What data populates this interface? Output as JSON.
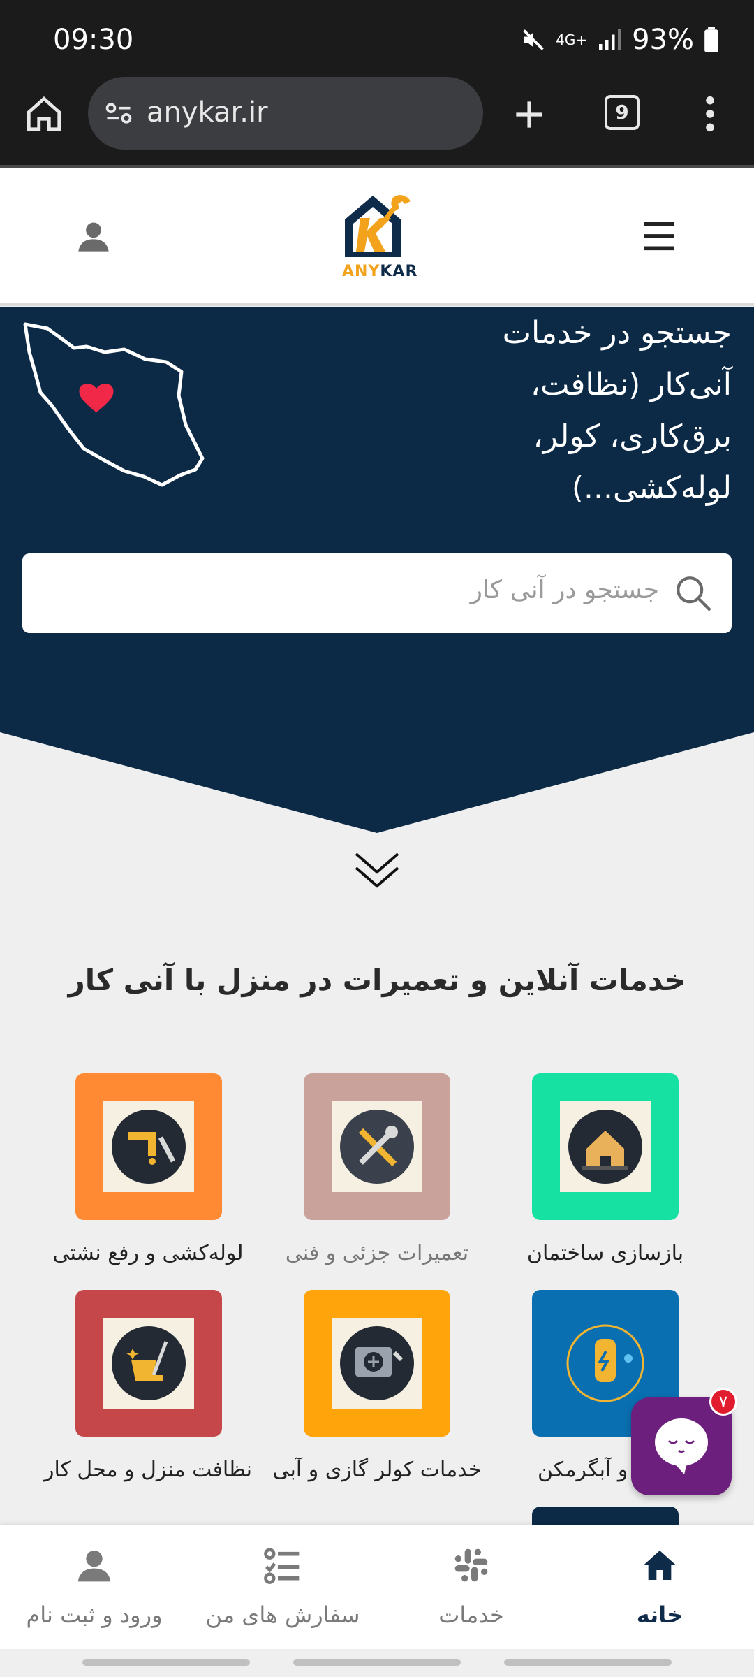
{
  "status_bar": {
    "time": "09:30",
    "network": "4G+",
    "battery": "93%"
  },
  "browser": {
    "url": "anykar.ir",
    "tab_count": "9"
  },
  "header": {
    "logo_text_left": "ANY",
    "logo_text_right": "KAR"
  },
  "hero": {
    "title_lines": [
      "جستجو در خدمات",
      "آنی‌کار (نظافت،",
      "برق‌کاری، کولر،",
      "لوله‌کشی...)"
    ],
    "search_placeholder": "جستجو در آنی کار"
  },
  "section": {
    "title": "خدمات آنلاین و تعمیرات در منزل با آنی کار"
  },
  "services": [
    {
      "label": "بازسازی ساختمان",
      "color": "#17e0a3"
    },
    {
      "label": "تعمیرات جزئی و فنی",
      "color": "#c9a39b"
    },
    {
      "label": "لوله‌کشی و رفع نشتی",
      "color": "#ff8a33"
    },
    {
      "label": "و آبگرمکن",
      "color": "#0a6fb1"
    },
    {
      "label": "خدمات کولر گازی و آبی",
      "color": "#ffa40a"
    },
    {
      "label": "نظافت منزل و محل کار",
      "color": "#c6474a"
    }
  ],
  "chat": {
    "badge": "۷"
  },
  "bottom_nav": [
    {
      "label": "خانه",
      "icon": "home-icon",
      "active": true
    },
    {
      "label": "خدمات",
      "icon": "services-icon",
      "active": false
    },
    {
      "label": "سفارش های من",
      "icon": "orders-icon",
      "active": false
    },
    {
      "label": "ورود و ثبت نام",
      "icon": "user-icon",
      "active": false
    }
  ],
  "colors": {
    "navy": "#0f2b4a",
    "accent": "#f2a31b"
  }
}
